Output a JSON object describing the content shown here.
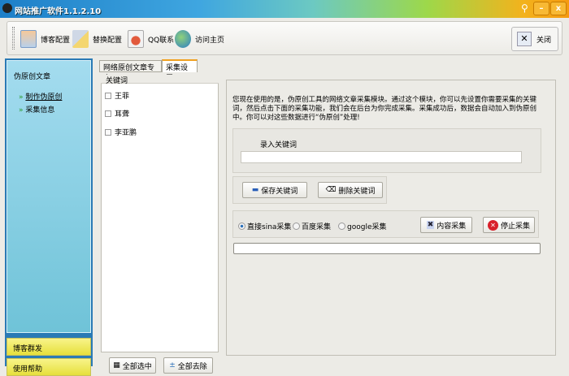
{
  "window": {
    "title": "网站推广软件1.1.2.10",
    "minimize": "–",
    "close": "x"
  },
  "toolbar": {
    "items": [
      {
        "label": "博客配置",
        "icon": "blog-config-icon"
      },
      {
        "label": "替换配置",
        "icon": "replace-config-icon"
      },
      {
        "label": "QQ联系",
        "icon": "qq-contact-icon"
      },
      {
        "label": "访问主页",
        "icon": "globe-icon"
      }
    ],
    "close_label": "关闭"
  },
  "sidebar": {
    "section": "伪原创文章",
    "items": [
      {
        "label": "制作伪原创"
      },
      {
        "label": "采集信息"
      }
    ],
    "bottom": [
      "博客群发",
      "使用帮助"
    ]
  },
  "tabs": [
    {
      "label": "网络原创文章专家",
      "active": false
    },
    {
      "label": "采集设置",
      "active": true
    }
  ],
  "keywords": {
    "header": "关键词",
    "items": [
      "王菲",
      "耳聋",
      "李亚鹏"
    ],
    "select_all": "全部选中",
    "remove_all": "全部去除"
  },
  "main": {
    "description": "您现在使用的是，伪原创工具的网络文章采集模块。通过这个模块，你可以先设置你需要采集的关键词，然后点击下面的采集功能，我们会在后台为你完成采集。采集成功后，数据会自动加入到伪原创中。你可以对这些数据进行“伪原创”处理!",
    "input_label": "录入关键词",
    "input_value": "",
    "save_label": "保存关键词",
    "delete_label": "删除关键词",
    "radios": [
      {
        "label": "直接sina采集",
        "checked": true
      },
      {
        "label": "百度采集",
        "checked": false
      },
      {
        "label": "google采集",
        "checked": false
      }
    ],
    "collect_label": "内容采集",
    "stop_label": "停止采集",
    "progress": 0
  }
}
